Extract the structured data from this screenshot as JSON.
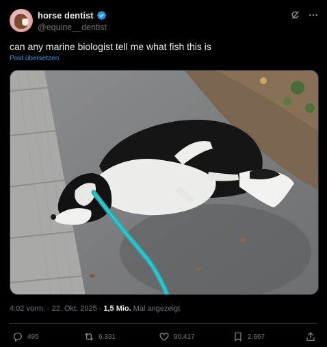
{
  "author": {
    "display_name": "horse dentist",
    "handle": "@equine__dentist",
    "verified": true,
    "avatar_icon": "horse-dentist-avatar"
  },
  "post": {
    "text": "can any marine biologist tell me what fish this is",
    "translate_label": "Post übersetzen",
    "media": {
      "type": "photo",
      "subject": "black-and-white dog lying on pavement with teal leash"
    }
  },
  "meta": {
    "time": "4:02 vorm.",
    "separator": "·",
    "date": "22. Okt. 2025",
    "views_count": "1,5 Mio.",
    "views_label": "Mal angezeigt"
  },
  "actions": {
    "replies": "495",
    "reposts": "6.331",
    "likes": "90.417",
    "bookmarks": "2.667"
  },
  "colors": {
    "background": "#000000",
    "text_primary": "#e7e9ea",
    "text_secondary": "#71767b",
    "accent": "#1d9bf0",
    "divider": "#2f3336",
    "leash": "#1fb3b8"
  }
}
